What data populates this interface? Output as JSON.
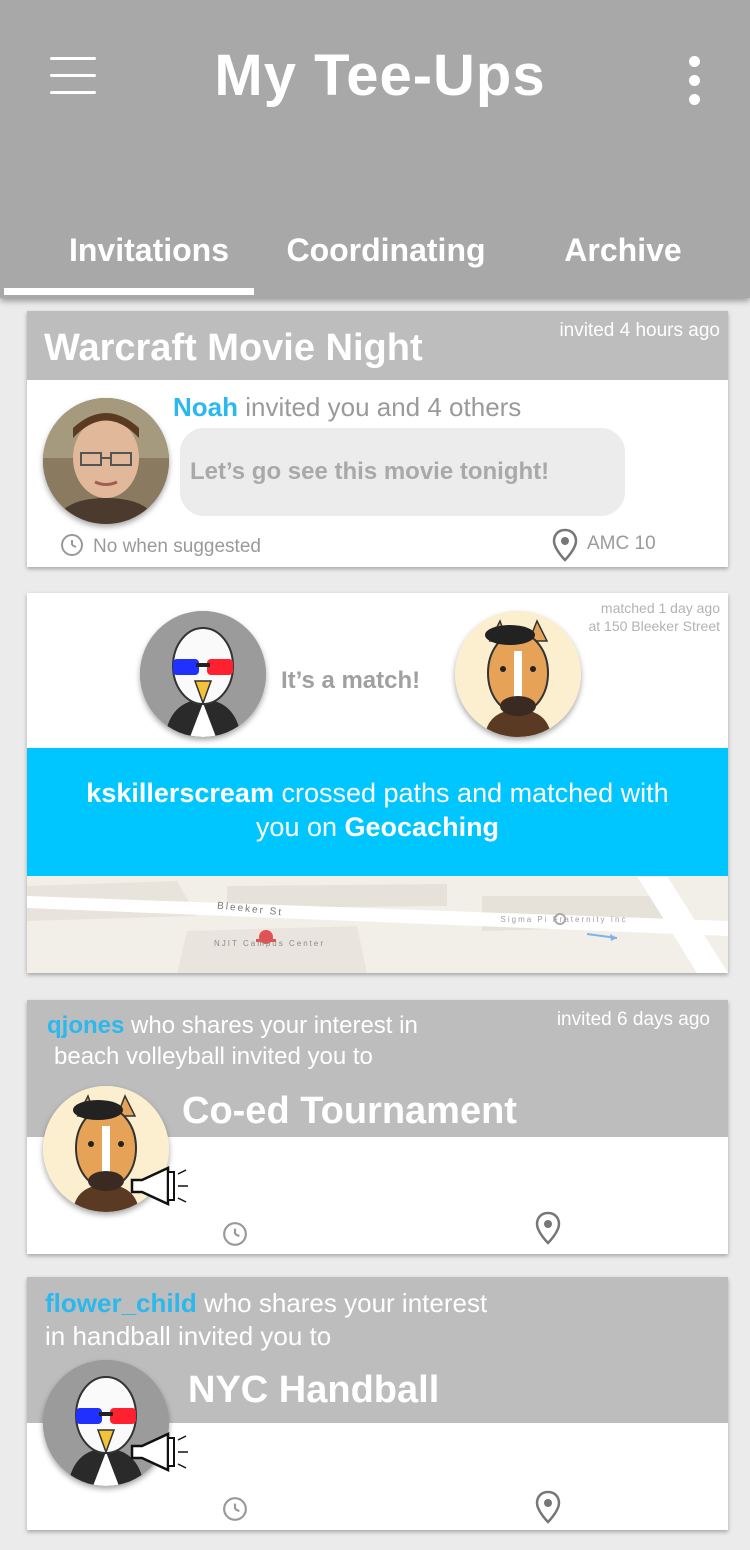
{
  "header": {
    "title": "My Tee-Ups",
    "tabs": [
      {
        "label": "Invitations",
        "active": true
      },
      {
        "label": "Coordinating",
        "active": false
      },
      {
        "label": "Archive",
        "active": false
      }
    ]
  },
  "cards": {
    "movie": {
      "time": "invited 4 hours ago",
      "title": "Warcraft Movie Night",
      "inviter": "Noah",
      "invite_text": "invited you and 4 others",
      "message": "Let’s go see this movie tonight!",
      "when": "No when suggested",
      "where": "AMC 10"
    },
    "match": {
      "time_line1": "matched 1 day ago",
      "time_line2": "at 150 Bleeker Street",
      "match_text": "It’s a match!",
      "user": "kskillerscream",
      "text_1": "crossed paths and matched with",
      "text_2": "you on",
      "activity": "Geocaching",
      "map": {
        "street": "Bleeker St",
        "poi_1": "NJIT Campus Center",
        "poi_2": "Sigma Pi Fraternity Inc"
      }
    },
    "coed": {
      "user": "qjones",
      "text_1": "who shares your interest in",
      "text_2": "beach volleyball invited you to",
      "time": "invited 6 days ago",
      "title": "Co-ed Tournament"
    },
    "handball": {
      "user": "flower_child",
      "text_1": "who shares your interest",
      "text_2": "in handball invited you to",
      "title": "NYC Handball"
    }
  },
  "colors": {
    "header_gray": "#a8a8a8",
    "card_gray": "#bdbdbd",
    "accent_blue": "#2ab8ee",
    "cyan": "#00c6ff"
  }
}
